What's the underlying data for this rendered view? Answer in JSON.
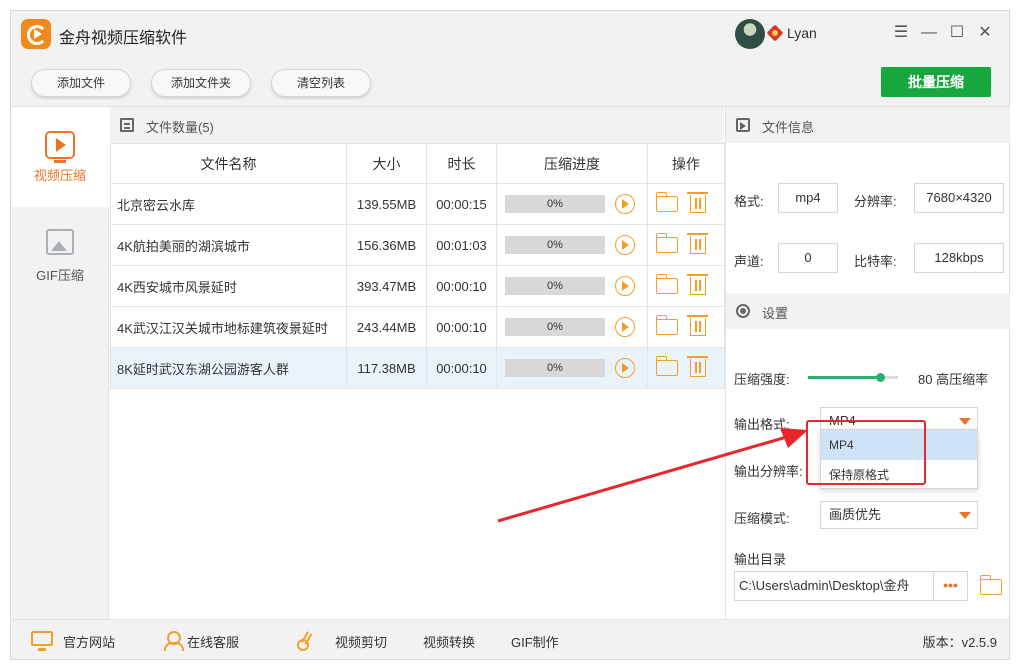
{
  "app": {
    "title": "金舟视频压缩软件",
    "username": "Lyan"
  },
  "window_controls": {
    "menu": "☰",
    "minimize": "—",
    "maximize": "☐",
    "close": "✕"
  },
  "toolbar": {
    "add_file": "添加文件",
    "add_folder": "添加文件夹",
    "clear_list": "清空列表",
    "batch_compress": "批量压缩"
  },
  "sidebar": {
    "items": [
      {
        "label": "视频压缩",
        "active": true
      },
      {
        "label": "GIF压缩",
        "active": false
      }
    ]
  },
  "file_list": {
    "header": "文件数量(5)",
    "columns": [
      "文件名称",
      "大小",
      "时长",
      "压缩进度",
      "操作"
    ],
    "rows": [
      {
        "name": "北京密云水库",
        "size": "139.55MB",
        "duration": "00:00:15",
        "progress": "0%"
      },
      {
        "name": "4K航拍美丽的湖滨城市",
        "size": "156.36MB",
        "duration": "00:01:03",
        "progress": "0%"
      },
      {
        "name": "4K西安城市风景延时",
        "size": "393.47MB",
        "duration": "00:00:10",
        "progress": "0%"
      },
      {
        "name": "4K武汉江汉关城市地标建筑夜景延时",
        "size": "243.44MB",
        "duration": "00:00:10",
        "progress": "0%"
      },
      {
        "name": "8K延时武汉东湖公园游客人群",
        "size": "117.38MB",
        "duration": "00:00:10",
        "progress": "0%"
      }
    ],
    "selected_row": 4
  },
  "file_info": {
    "title": "文件信息",
    "format_label": "格式:",
    "format": "mp4",
    "resolution_label": "分辨率:",
    "resolution": "7680×4320",
    "channel_label": "声道:",
    "channel": "0",
    "bitrate_label": "比特率:",
    "bitrate": "128kbps"
  },
  "settings": {
    "title": "设置",
    "strength_label": "压缩强度:",
    "strength_value": 80,
    "strength_text": "80 高压缩率",
    "output_format_label": "输出格式:",
    "output_format": "MP4",
    "format_options": [
      "MP4",
      "保持原格式"
    ],
    "output_resolution_label": "输出分辨率:",
    "mode_label": "压缩模式:",
    "mode": "画质优先",
    "output_dir_label": "输出目录",
    "output_dir": "C:\\Users\\admin\\Desktop\\金舟",
    "browse": "•••"
  },
  "footer": {
    "website": "官方网站",
    "support": "在线客服",
    "cut": "视频剪切",
    "convert": "视频转换",
    "gif": "GIF制作",
    "version": "版本：v2.5.9"
  },
  "colors": {
    "accent": "#e8742a",
    "primary_green": "#18a63e",
    "slider": "#28b070",
    "annotation_red": "#e8262b"
  }
}
